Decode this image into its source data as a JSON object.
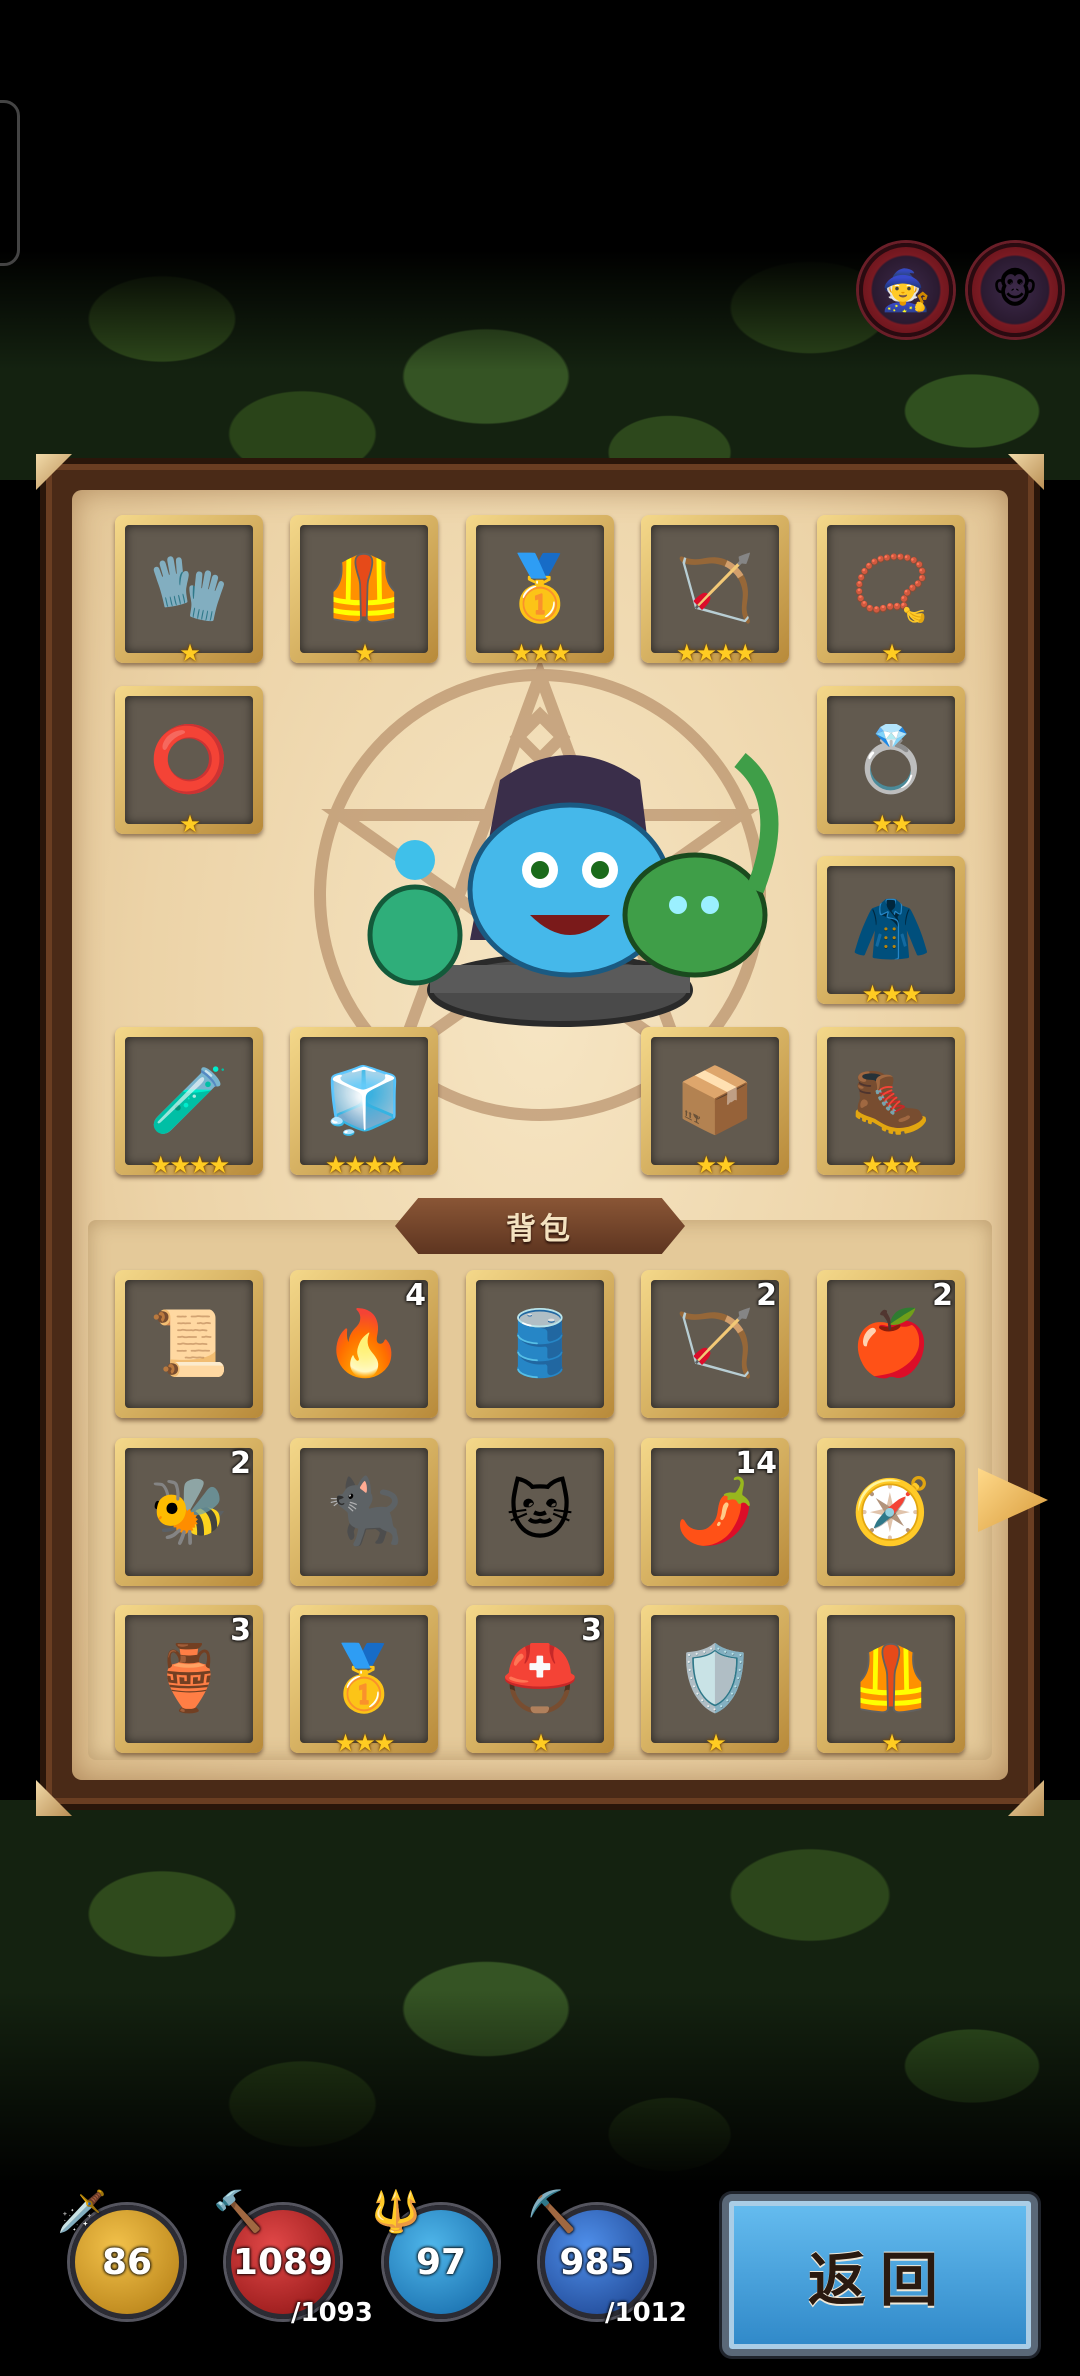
{
  "bag_title": "背包",
  "return_label": "返回",
  "equipped": [
    {
      "icon": "gauntlet-icon",
      "glyph": "🧤",
      "stars": "★"
    },
    {
      "icon": "chest-armor-icon",
      "glyph": "🦺",
      "stars": "★"
    },
    {
      "icon": "gold-bracer-icon",
      "glyph": "🥇",
      "stars": "★★★"
    },
    {
      "icon": "crossbow-icon",
      "glyph": "🏹",
      "stars": "★★★★"
    },
    {
      "icon": "amulet-icon",
      "glyph": "📿",
      "stars": "★"
    },
    {
      "icon": "silver-bracelet-icon",
      "glyph": "⭕",
      "stars": "★"
    },
    {
      "icon": "gem-ring-icon",
      "glyph": "💍",
      "stars": "★★"
    },
    {
      "icon": "fur-cloak-icon",
      "glyph": "🧥",
      "stars": "★★★"
    },
    {
      "icon": "potion-gourd-icon",
      "glyph": "🧪",
      "stars": "★★★★"
    },
    {
      "icon": "ice-tablet-icon",
      "glyph": "🧊",
      "stars": "★★★★"
    },
    {
      "icon": "treasure-chest-icon",
      "glyph": "📦",
      "stars": "★★"
    },
    {
      "icon": "fur-boots-icon",
      "glyph": "🥾",
      "stars": "★★★"
    }
  ],
  "bag": [
    {
      "icon": "scroll-map-icon",
      "glyph": "📜",
      "count": "",
      "stars": ""
    },
    {
      "icon": "torch-icon",
      "glyph": "🔥",
      "count": "4",
      "stars": ""
    },
    {
      "icon": "powder-keg-icon",
      "glyph": "🛢️",
      "count": "",
      "stars": ""
    },
    {
      "icon": "arrow-icon",
      "glyph": "🏹",
      "count": "2",
      "stars": ""
    },
    {
      "icon": "apple-icon",
      "glyph": "🍎",
      "count": "2",
      "stars": ""
    },
    {
      "icon": "beehive-icon",
      "glyph": "🐝",
      "count": "2",
      "stars": ""
    },
    {
      "icon": "black-cat-statue-icon",
      "glyph": "🐈‍⬛",
      "count": "",
      "stars": ""
    },
    {
      "icon": "zombie-cat-icon",
      "glyph": "🐱",
      "count": "",
      "stars": ""
    },
    {
      "icon": "chili-pepper-icon",
      "glyph": "🌶️",
      "count": "14",
      "stars": ""
    },
    {
      "icon": "compass-icon",
      "glyph": "🧭",
      "count": "",
      "stars": ""
    },
    {
      "icon": "blue-vase-icon",
      "glyph": "🏺",
      "count": "3",
      "stars": ""
    },
    {
      "icon": "gold-bracer-icon",
      "glyph": "🥇",
      "count": "",
      "stars": "★★★"
    },
    {
      "icon": "knight-helmet-icon",
      "glyph": "⛑️",
      "count": "3",
      "stars": "★"
    },
    {
      "icon": "plate-armor-icon",
      "glyph": "🛡️",
      "count": "",
      "stars": "★"
    },
    {
      "icon": "chest-armor-icon",
      "glyph": "🦺",
      "count": "",
      "stars": "★"
    }
  ],
  "stats": {
    "attack": {
      "value": "86",
      "icon": "sword-icon",
      "glyph": "🗡️"
    },
    "hp": {
      "value": "1089",
      "max": "/1093",
      "icon": "hammer-icon",
      "glyph": "🔨"
    },
    "defense": {
      "value": "97",
      "icon": "spear-icon",
      "glyph": "🔱"
    },
    "mp": {
      "value": "985",
      "max": "/1012",
      "icon": "pickaxe-icon",
      "glyph": "⛏️"
    }
  }
}
